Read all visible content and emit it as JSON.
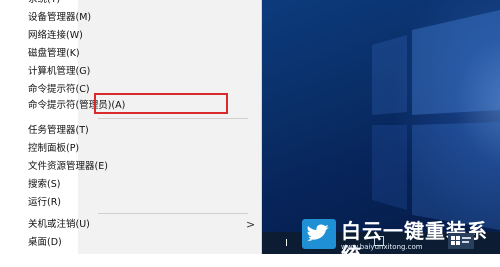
{
  "context_menu": {
    "items": [
      {
        "label": "系统(Y)"
      },
      {
        "label": "设备管理器(M)"
      },
      {
        "label": "网络连接(W)"
      },
      {
        "label": "磁盘管理(K)"
      },
      {
        "label": "计算机管理(G)"
      },
      {
        "label": "命令提示符(C)"
      },
      {
        "label": "命令提示符(管理员)(A)"
      },
      {
        "label": "任务管理器(T)"
      },
      {
        "label": "控制面板(P)"
      },
      {
        "label": "文件资源管理器(E)"
      },
      {
        "label": "搜索(S)"
      },
      {
        "label": "运行(R)"
      },
      {
        "label": "关机或注销(U)"
      },
      {
        "label": "桌面(D)"
      }
    ],
    "submenu_indicator": ">"
  },
  "watermark": {
    "brand_text": "白云一键重装系统",
    "url_text": "www.baiyunxitong.com"
  },
  "taskbar": {
    "cursor_glyph": "I"
  },
  "colors": {
    "highlight": "#d92b2b",
    "desktop_blue": "#0a2f68",
    "logo_blue": "#1f8fd6"
  }
}
